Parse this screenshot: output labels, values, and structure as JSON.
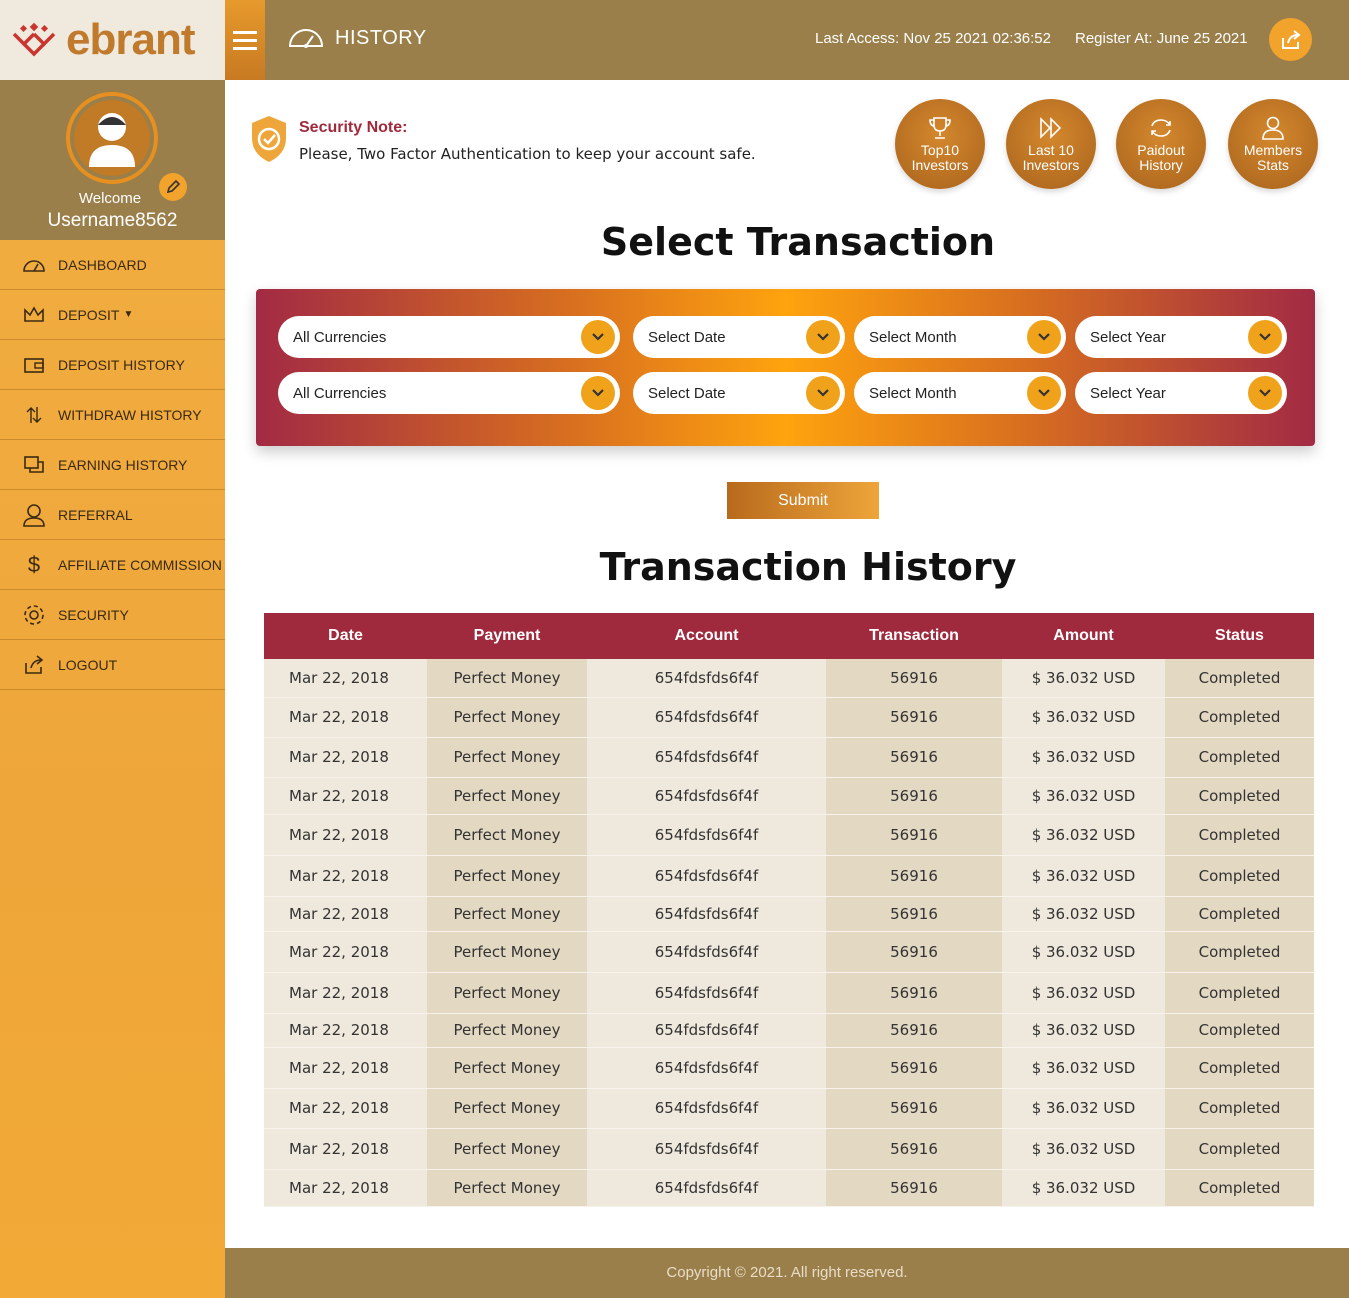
{
  "brand": {
    "name": "ebrant"
  },
  "header": {
    "title": "HISTORY",
    "last_access": "Last Access:  Nov 25 2021 02:36:52",
    "register_at": "Register At:  June 25 2021"
  },
  "profile": {
    "welcome": "Welcome",
    "username": "Username8562"
  },
  "sidebar": {
    "items": [
      {
        "label": "DASHBOARD",
        "icon": "dashboard-icon"
      },
      {
        "label": "DEPOSIT",
        "icon": "crown-icon"
      },
      {
        "label": "DEPOSIT HISTORY",
        "icon": "wallet-icon"
      },
      {
        "label": "WITHDRAW HISTORY",
        "icon": "transfer-icon"
      },
      {
        "label": "EARNING HISTORY",
        "icon": "copy-icon"
      },
      {
        "label": "REFERRAL",
        "icon": "user-icon"
      },
      {
        "label": "AFFILIATE COMMISSION",
        "icon": "dollar-icon"
      },
      {
        "label": "SECURITY",
        "icon": "gear-icon"
      },
      {
        "label": "LOGOUT",
        "icon": "logout-icon"
      }
    ]
  },
  "security_note": {
    "title": "Security Note:",
    "text": "Please, Two Factor Authentication to keep your account safe."
  },
  "quick_links": [
    {
      "label": "Top10\nInvestors",
      "icon": "trophy-icon"
    },
    {
      "label": "Last 10\nInvestors",
      "icon": "fast-forward-icon"
    },
    {
      "label": "Paidout\nHistory",
      "icon": "refresh-icon"
    },
    {
      "label": "Members\nStats",
      "icon": "member-icon"
    }
  ],
  "filter": {
    "heading": "Select Transaction",
    "rows": [
      {
        "currency": "All Currencies",
        "date": "Select Date",
        "month": "Select Month",
        "year": "Select Year"
      },
      {
        "currency": "All Currencies",
        "date": "Select Date",
        "month": "Select Month",
        "year": "Select Year"
      }
    ],
    "submit_label": "Submit"
  },
  "history": {
    "heading": "Transaction History",
    "columns": [
      "Date",
      "Payment",
      "Account",
      "Transaction",
      "Amount",
      "Status"
    ],
    "rows": [
      [
        "Mar 22, 2018",
        "Perfect Money",
        "654fdsfds6f4f",
        "56916",
        "$ 36.032 USD",
        "Completed"
      ],
      [
        "Mar 22, 2018",
        "Perfect Money",
        "654fdsfds6f4f",
        "56916",
        "$ 36.032 USD",
        "Completed"
      ],
      [
        "Mar 22, 2018",
        "Perfect Money",
        "654fdsfds6f4f",
        "56916",
        "$ 36.032 USD",
        "Completed"
      ],
      [
        "Mar 22, 2018",
        "Perfect Money",
        "654fdsfds6f4f",
        "56916",
        "$ 36.032 USD",
        "Completed"
      ],
      [
        "Mar 22, 2018",
        "Perfect Money",
        "654fdsfds6f4f",
        "56916",
        "$ 36.032 USD",
        "Completed"
      ],
      [
        "Mar 22, 2018",
        "Perfect Money",
        "654fdsfds6f4f",
        "56916",
        "$ 36.032 USD",
        "Completed"
      ],
      [
        "Mar 22, 2018",
        "Perfect Money",
        "654fdsfds6f4f",
        "56916",
        "$ 36.032 USD",
        "Completed"
      ],
      [
        "Mar 22, 2018",
        "Perfect Money",
        "654fdsfds6f4f",
        "56916",
        "$ 36.032 USD",
        "Completed"
      ],
      [
        "Mar 22, 2018",
        "Perfect Money",
        "654fdsfds6f4f",
        "56916",
        "$ 36.032 USD",
        "Completed"
      ],
      [
        "Mar 22, 2018",
        "Perfect Money",
        "654fdsfds6f4f",
        "56916",
        "$ 36.032 USD",
        "Completed"
      ],
      [
        "Mar 22, 2018",
        "Perfect Money",
        "654fdsfds6f4f",
        "56916",
        "$ 36.032 USD",
        "Completed"
      ],
      [
        "Mar 22, 2018",
        "Perfect Money",
        "654fdsfds6f4f",
        "56916",
        "$ 36.032 USD",
        "Completed"
      ],
      [
        "Mar 22, 2018",
        "Perfect Money",
        "654fdsfds6f4f",
        "56916",
        "$ 36.032 USD",
        "Completed"
      ],
      [
        "Mar 22, 2018",
        "Perfect Money",
        "654fdsfds6f4f",
        "56916",
        "$ 36.032 USD",
        "Completed"
      ]
    ]
  },
  "footer": {
    "text": "Copyright © 2021. All right reserved."
  },
  "colors": {
    "accent": "#f0a21a",
    "header": "#9a7f4a",
    "table_head": "#9f2a3d"
  }
}
